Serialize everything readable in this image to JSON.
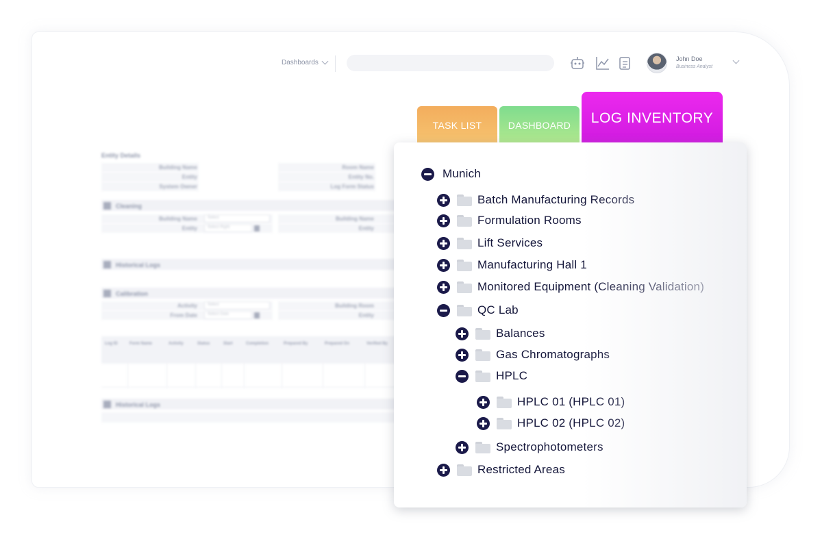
{
  "header": {
    "dashboards_label": "Dashboards",
    "user_name": "John Doe",
    "user_role": "Business Analyst"
  },
  "form": {
    "entity_details_title": "Entity Details",
    "fields_left": [
      "Building Name",
      "Entity",
      "System Owner"
    ],
    "fields_right": [
      "Room Name",
      "Entity No.",
      "Log Form Status"
    ],
    "cleaning_title": "Cleaning",
    "cleaning_left_labels": [
      "Building Name",
      "Entity"
    ],
    "cleaning_left_values": [
      "Select",
      "Select Right"
    ],
    "cleaning_right_labels": [
      "Building Name",
      "Entity"
    ],
    "historical_logs_title": "Historical Logs",
    "calibration_title": "Calibration",
    "calibration_left_labels": [
      "Activity",
      "From Date"
    ],
    "calibration_left_values": [
      "Select",
      "Select Date"
    ],
    "calibration_right_labels": [
      "Building Room",
      "Entity"
    ],
    "table_headers": [
      "Log ID",
      "Form Name",
      "Activity",
      "Status",
      "Start",
      "Completion",
      "Prepared By",
      "Prepared On",
      "Verified By"
    ],
    "historical_logs_title_2": "Historical Logs"
  },
  "tabs": {
    "task_list": "TASK LIST",
    "dashboard": "DASHBOARD",
    "log_inventory": "LOG INVENTORY"
  },
  "tree": {
    "root": "Munich",
    "level1": [
      "Batch Manufacturing Records",
      "Formulation Rooms",
      "Lift Services",
      "Manufacturing Hall 1",
      "Monitored Equipment (Cleaning Validation)",
      "QC Lab",
      "Restricted Areas"
    ],
    "qc_children": [
      "Balances",
      "Gas Chromatographs",
      "HPLC",
      "Spectrophotometers"
    ],
    "hplc_children": [
      "HPLC 01 (HPLC 01)",
      "HPLC 02 (HPLC 02)"
    ]
  },
  "colors": {
    "task_tab": "#f3ad5d",
    "dashboard_tab": "#7fdc8e",
    "log_tab": "#e226eb",
    "tree_text": "#14163a",
    "toggle": "#1b1a4a"
  }
}
